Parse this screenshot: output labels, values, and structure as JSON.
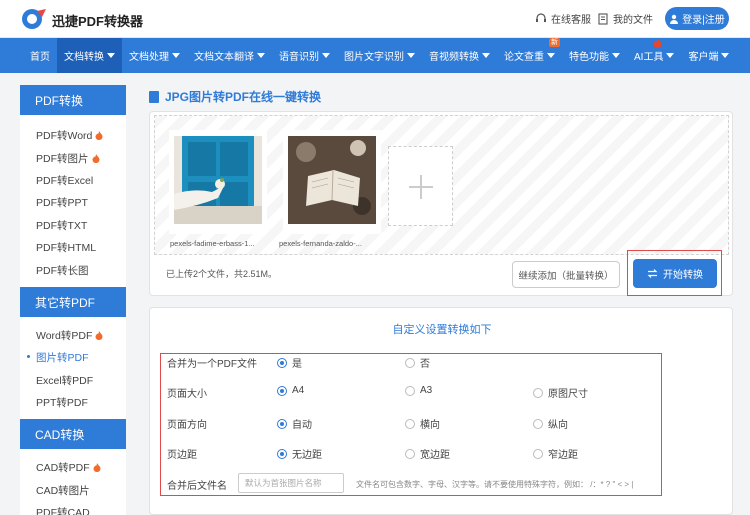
{
  "header": {
    "logo_text": "迅捷PDF转换器",
    "service_label": "在线客服",
    "my_files_label": "我的文件",
    "login_label": "登录|注册"
  },
  "nav": {
    "items": [
      {
        "label": "首页",
        "caret": false
      },
      {
        "label": "文档转换",
        "caret": true,
        "active": true
      },
      {
        "label": "文档处理",
        "caret": true
      },
      {
        "label": "文档文本翻译",
        "caret": true
      },
      {
        "label": "语音识别",
        "caret": true
      },
      {
        "label": "图片文字识别",
        "caret": true
      },
      {
        "label": "音视频转换",
        "caret": true
      },
      {
        "label": "论文查重",
        "caret": true,
        "badge": "新"
      },
      {
        "label": "特色功能",
        "caret": true
      },
      {
        "label": "AI工具",
        "caret": true,
        "fire": true
      },
      {
        "label": "客户端",
        "caret": true
      }
    ]
  },
  "sidebar": {
    "sections": [
      {
        "title": "PDF转换",
        "items": [
          {
            "label": "PDF转Word",
            "hot": true
          },
          {
            "label": "PDF转图片",
            "hot": true
          },
          {
            "label": "PDF转Excel"
          },
          {
            "label": "PDF转PPT"
          },
          {
            "label": "PDF转TXT"
          },
          {
            "label": "PDF转HTML"
          },
          {
            "label": "PDF转长图"
          }
        ]
      },
      {
        "title": "其它转PDF",
        "items": [
          {
            "label": "Word转PDF",
            "hot": true
          },
          {
            "label": "图片转PDF",
            "active": true
          },
          {
            "label": "Excel转PDF"
          },
          {
            "label": "PPT转PDF"
          }
        ]
      },
      {
        "title": "CAD转换",
        "items": [
          {
            "label": "CAD转PDF",
            "hot": true
          },
          {
            "label": "CAD转图片"
          },
          {
            "label": "PDF转CAD"
          }
        ]
      }
    ]
  },
  "main": {
    "title": "JPG图片转PDF在线一键转换",
    "files": [
      {
        "name": "pexels-fadime-erbass-1..."
      },
      {
        "name": "pexels-fernanda-zaldo-..."
      }
    ],
    "upload_status": "已上传2个文件，共2.51M。",
    "continue_button": "继续添加（批量转换）",
    "start_button": "开始转换"
  },
  "settings": {
    "title": "自定义设置转换如下",
    "rows": [
      {
        "label": "合并为一个PDF文件",
        "options": [
          {
            "label": "是",
            "selected": true
          },
          {
            "label": "否"
          }
        ]
      },
      {
        "label": "页面大小",
        "options": [
          {
            "label": "A4",
            "selected": true
          },
          {
            "label": "A3"
          },
          {
            "label": "原图尺寸"
          }
        ]
      },
      {
        "label": "页面方向",
        "options": [
          {
            "label": "自动",
            "selected": true
          },
          {
            "label": "横向"
          },
          {
            "label": "纵向"
          }
        ]
      },
      {
        "label": "页边距",
        "options": [
          {
            "label": "无边距",
            "selected": true
          },
          {
            "label": "宽边距"
          },
          {
            "label": "窄边距"
          }
        ]
      }
    ],
    "filename_label": "合并后文件名",
    "filename_placeholder": "默认为首张图片名称",
    "filename_hint": "文件名可包含数字、字母、汉字等。请不要使用特殊字符，例如：  /：* ? \" < > |"
  },
  "colors": {
    "brand": "#2f7bd8",
    "highlight": "#e04a4a",
    "hot": "#f36b2b"
  }
}
